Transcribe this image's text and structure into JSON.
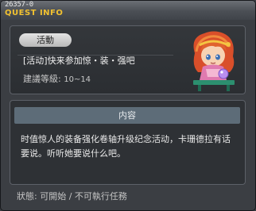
{
  "window": {
    "quest_id": "26357-0",
    "title": "QUEST INFO"
  },
  "summary": {
    "tag": "活動",
    "quest_name": "[活动]快来参加惊・装・强吧",
    "level_label": "建議等級:",
    "level_range": "10~14",
    "npc_icon": "npc-girl-portrait"
  },
  "details": {
    "header": "内容",
    "description": "时值惊人的装备强化卷轴升级纪念活动，卡珊德拉有话要说。听听她要说什么吧。"
  },
  "status": {
    "label": "狀態:",
    "value": "可開始 / 不可執行任務"
  },
  "colors": {
    "title_accent": "#f2c230",
    "section_header": "#5d6c78"
  }
}
